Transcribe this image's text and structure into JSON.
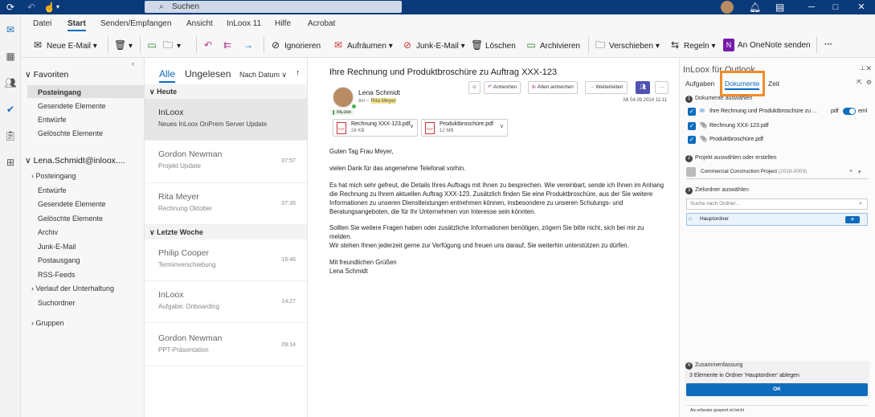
{
  "titlebar": {
    "search_placeholder": "Suchen"
  },
  "ribbon_tabs": [
    "Datei",
    "Start",
    "Senden/Empfangen",
    "Ansicht",
    "InLoox 11",
    "Hilfe",
    "Acrobat"
  ],
  "ribbon": {
    "new_mail": "Neue E-Mail",
    "ignore": "Ignorieren",
    "cleanup": "Aufräumen",
    "junk": "Junk-E-Mail",
    "delete": "Löschen",
    "archive": "Archivieren",
    "move": "Verschieben",
    "rules": "Regeln",
    "onenote": "An OneNote senden",
    "more": "···"
  },
  "folders": {
    "favorites_header": "Favoriten",
    "favorites": [
      "Posteingang",
      "Gesendete Elemente",
      "Entwürfe",
      "Gelöschte Elemente"
    ],
    "account_header": "Lena.Schmidt@inloox....",
    "account_items": [
      "Posteingang",
      "Entwürfe",
      "Gesendete Elemente",
      "Gelöschte Elemente",
      "Archiv",
      "Junk-E-Mail",
      "Postausgang",
      "RSS-Feeds",
      "Verlauf der Unterhaltung",
      "Suchordner"
    ],
    "groups_header": "Gruppen"
  },
  "list": {
    "tab_all": "Alle",
    "tab_unread": "Ungelesen",
    "sort": "Nach Datum",
    "group_today": "Heute",
    "group_last_week": "Letzte Woche",
    "messages": [
      {
        "sender": "InLoox",
        "preview": "Neues InLoox OnPrem Server Update",
        "time": ""
      },
      {
        "sender": "Gordon Newman",
        "preview": "Projekt Update",
        "time": "07:57"
      },
      {
        "sender": "Rita Meyer",
        "preview": "Rechnung Oktober",
        "time": "07:35"
      },
      {
        "sender": "Philip Cooper",
        "preview": "Terminverschiebung",
        "time": "16:46"
      },
      {
        "sender": "InLoox",
        "preview": "Aufgabe: Onboarding",
        "time": "14:27"
      },
      {
        "sender": "Gordon Newman",
        "preview": "PPT-Präsentation",
        "time": "09:14"
      }
    ]
  },
  "reading": {
    "subject": "Ihre Rechnung und Produktbroschüre zu Auftrag XXX-123",
    "sender": "Lena Schmidt",
    "to_label": "An",
    "to_name": "Rita Meyer",
    "date": "Mi 04.09.2024 11:11",
    "tag": "InLoox",
    "reply": "Antworten",
    "reply_all": "Allen antworten",
    "forward": "Weiterleiten",
    "attachments": [
      {
        "name": "Rechnung XXX-123.pdf",
        "size": "28 KB"
      },
      {
        "name": "Produktbroschüre.pdf",
        "size": "12 MB"
      }
    ],
    "body": [
      "Guten Tag Frau Meyer,",
      "vielen Dank für das angenehme Telefonat vorhin.",
      "Es hat mich sehr gefreut, die Details Ihres Auftrags mit Ihnen zu besprechen. Wie vereinbart, sende ich Ihnen im Anhang die Rechnung zu Ihrem aktuellen Auftrag XXX-123. Zusätzlich finden Sie eine Produktbroschüre, aus der Sie weitere Informationen zu unseren Dienstleistungen entnehmen können, insbesondere zu unseren Schulungs- und Beratungsangeboten, die für Ihr Unternehmen von Interesse sein könnten.",
      "Sollten Sie weitere Fragen haben oder zusätzliche Informationen benötigen, zögern Sie bitte nicht, sich bei mir zu melden.\nWir stehen Ihnen jederzeit gerne zur Verfügung und freuen uns darauf, Sie weiterhin unterstützen zu dürfen.",
      "Mit freundlichen Grüßen\nLena Schmidt"
    ]
  },
  "addin": {
    "title": "InLoox für Outlook",
    "tabs": [
      "Aufgaben",
      "Dokumente",
      "Zeit"
    ],
    "step1": "Dokumente auswählen",
    "mail_item": "Ihre Rechnung und Produktbroschüre zu ...",
    "pdf_label": "pdf",
    "eml_label": "eml",
    "file1": "Rechnung XXX-123.pdf",
    "file2": "Produktbroschüre.pdf",
    "step2": "Projekt auswählen oder erstellen",
    "project": "Commercial Construction Project",
    "project_id": "(2018-0003)",
    "step3": "Zielordner auswählen",
    "folder_search": "Suche nach Ordner...",
    "folder": "Hauptordner",
    "step4": "Zusammenfassung",
    "summary": "3 Elemente in Ordner 'Hauptordner' ablegen",
    "ok": "OK",
    "footer": "Als erfasster gesperrt ist leicht"
  }
}
